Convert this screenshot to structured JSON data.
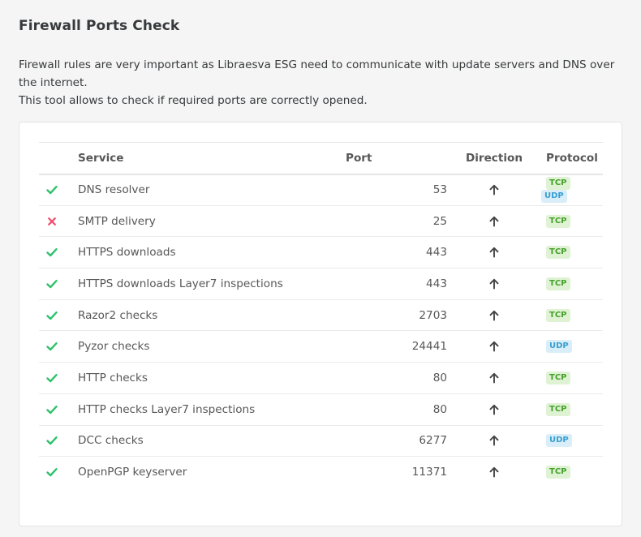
{
  "page": {
    "title": "Firewall Ports Check",
    "intro_line1": "Firewall rules are very important as Libraesva ESG need to communicate with update servers and DNS over the internet.",
    "intro_line2": "This tool allows to check if required ports are correctly opened."
  },
  "table": {
    "headers": {
      "service": "Service",
      "port": "Port",
      "direction": "Direction",
      "protocol": "Protocol"
    },
    "rows": [
      {
        "status": "ok",
        "service": "DNS resolver",
        "port": "53",
        "direction": "up-arrow",
        "protocols": [
          "TCP",
          "UDP"
        ]
      },
      {
        "status": "fail",
        "service": "SMTP delivery",
        "port": "25",
        "direction": "up-arrow",
        "protocols": [
          "TCP"
        ]
      },
      {
        "status": "ok",
        "service": "HTTPS downloads",
        "port": "443",
        "direction": "up-arrow",
        "protocols": [
          "TCP"
        ]
      },
      {
        "status": "ok",
        "service": "HTTPS downloads Layer7 inspections",
        "port": "443",
        "direction": "up-arrow",
        "protocols": [
          "TCP"
        ]
      },
      {
        "status": "ok",
        "service": "Razor2 checks",
        "port": "2703",
        "direction": "up-arrow",
        "protocols": [
          "TCP"
        ]
      },
      {
        "status": "ok",
        "service": "Pyzor checks",
        "port": "24441",
        "direction": "up-arrow",
        "protocols": [
          "UDP"
        ]
      },
      {
        "status": "ok",
        "service": "HTTP checks",
        "port": "80",
        "direction": "up-arrow",
        "protocols": [
          "TCP"
        ]
      },
      {
        "status": "ok",
        "service": "HTTP checks Layer7 inspections",
        "port": "80",
        "direction": "up-arrow",
        "protocols": [
          "TCP"
        ]
      },
      {
        "status": "ok",
        "service": "DCC checks",
        "port": "6277",
        "direction": "up-arrow",
        "protocols": [
          "UDP"
        ]
      },
      {
        "status": "ok",
        "service": "OpenPGP keyserver",
        "port": "11371",
        "direction": "up-arrow",
        "protocols": [
          "TCP"
        ]
      }
    ]
  },
  "colors": {
    "ok": "#2ec26a",
    "fail": "#f0506e",
    "tcp_bg": "#dff3d4",
    "tcp_fg": "#46a02b",
    "udp_bg": "#d9eef8",
    "udp_fg": "#3a9fd0"
  }
}
